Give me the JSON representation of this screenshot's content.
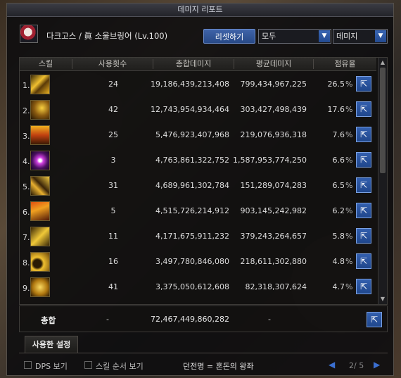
{
  "window": {
    "title": "데미지 리포트"
  },
  "character": {
    "name": "다크고스 / 眞 소울브링어 (Lv.100)"
  },
  "controls": {
    "reset_label": "리셋하기",
    "filter_value": "모두",
    "mode_value": "데미지"
  },
  "columns": {
    "skill": "스킬",
    "uses": "사용횟수",
    "total": "총합데미지",
    "average": "평균데미지",
    "share": "점유율"
  },
  "rows": [
    {
      "rank": "1.",
      "icon": "skill-slash-icon",
      "uses": "24",
      "total": "19,186,439,213,408",
      "avg": "799,434,967,225",
      "share": "26.5",
      "pct": "%"
    },
    {
      "rank": "2.",
      "icon": "skill-vortex-icon",
      "uses": "42",
      "total": "12,743,954,934,464",
      "avg": "303,427,498,439",
      "share": "17.6",
      "pct": "%"
    },
    {
      "rank": "3.",
      "icon": "skill-flame-icon",
      "uses": "25",
      "total": "5,476,923,407,968",
      "avg": "219,076,936,318",
      "share": "7.6",
      "pct": "%"
    },
    {
      "rank": "4.",
      "icon": "skill-burst-icon",
      "uses": "3",
      "total": "4,763,861,322,752",
      "avg": "1,587,953,774,250",
      "share": "6.6",
      "pct": "%"
    },
    {
      "rank": "5.",
      "icon": "skill-wave-icon",
      "uses": "31",
      "total": "4,689,961,302,784",
      "avg": "151,289,074,283",
      "share": "6.5",
      "pct": "%"
    },
    {
      "rank": "6.",
      "icon": "skill-spike-icon",
      "uses": "5",
      "total": "4,515,726,214,912",
      "avg": "903,145,242,982",
      "share": "6.2",
      "pct": "%"
    },
    {
      "rank": "7.",
      "icon": "skill-cross-icon",
      "uses": "11",
      "total": "4,171,675,911,232",
      "avg": "379,243,264,657",
      "share": "5.8",
      "pct": "%"
    },
    {
      "rank": "8.",
      "icon": "skill-crescent-icon",
      "uses": "16",
      "total": "3,497,780,846,080",
      "avg": "218,611,302,880",
      "share": "4.8",
      "pct": "%"
    },
    {
      "rank": "9.",
      "icon": "skill-fist-icon",
      "uses": "41",
      "total": "3,375,050,612,608",
      "avg": "82,318,307,624",
      "share": "4.7",
      "pct": "%"
    }
  ],
  "total_row": {
    "label": "총합",
    "uses": "-",
    "total": "72,467,449,860,282",
    "avg": "-"
  },
  "tab": {
    "label": "사용한 설정"
  },
  "bottom": {
    "dps_label": "DPS 보기",
    "order_label": "스킬 순서 보기",
    "dungeon": "던전명 = 혼돈의 왕좌",
    "pager": "2/ 5"
  },
  "colors": {
    "accent": "#2c55a3",
    "window_bg": "#0c0c0e",
    "skill_icon": "#d9a520"
  }
}
